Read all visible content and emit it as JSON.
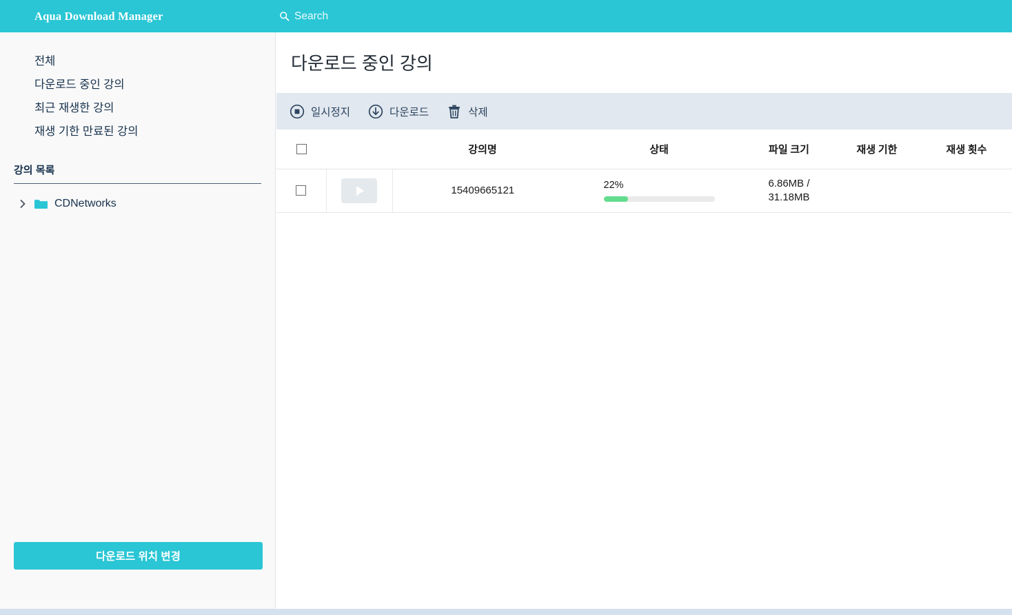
{
  "header": {
    "brand": "Aqua Download Manager",
    "search_icon": "search-icon",
    "search_label": "Search"
  },
  "sidebar": {
    "nav_items": [
      {
        "label": "전체"
      },
      {
        "label": "다운로드 중인 강의"
      },
      {
        "label": "최근 재생한 강의"
      },
      {
        "label": "재생 기한 만료된 강의"
      }
    ],
    "section_title": "강의 목록",
    "tree": [
      {
        "chevron_icon": "chevron-right-icon",
        "folder_icon": "folder-icon",
        "label": "CDNetworks"
      }
    ],
    "location_button": "다운로드 위치 변경"
  },
  "main": {
    "page_title": "다운로드 중인 강의",
    "toolbar": [
      {
        "icon": "pause-circle-icon",
        "label": "일시정지"
      },
      {
        "icon": "download-circle-icon",
        "label": "다운로드"
      },
      {
        "icon": "trash-icon",
        "label": "삭제"
      }
    ],
    "table": {
      "headers": {
        "check": "",
        "thumb": "",
        "name": "강의명",
        "state": "상태",
        "size": "파일 크기",
        "expiry": "재생 기한",
        "plays": "재생 횟수"
      },
      "rows": [
        {
          "checked": false,
          "thumb_icon": "play-icon",
          "name": "15409665121",
          "percent_label": "22%",
          "percent_value": 22,
          "size": "6.86MB / 31.18MB",
          "size_line1": "6.86MB /",
          "size_line2": "31.18MB",
          "expiry": "",
          "plays": ""
        }
      ]
    }
  },
  "colors": {
    "accent": "#2ac6d5",
    "toolbar_bg": "#e2e8ef",
    "sidebar_bg": "#f9f9f9",
    "progress_fill": "#63dd8d",
    "progress_track": "#eaeaea",
    "statusbar": "#d6e1ef",
    "text_dark": "#17314d"
  }
}
